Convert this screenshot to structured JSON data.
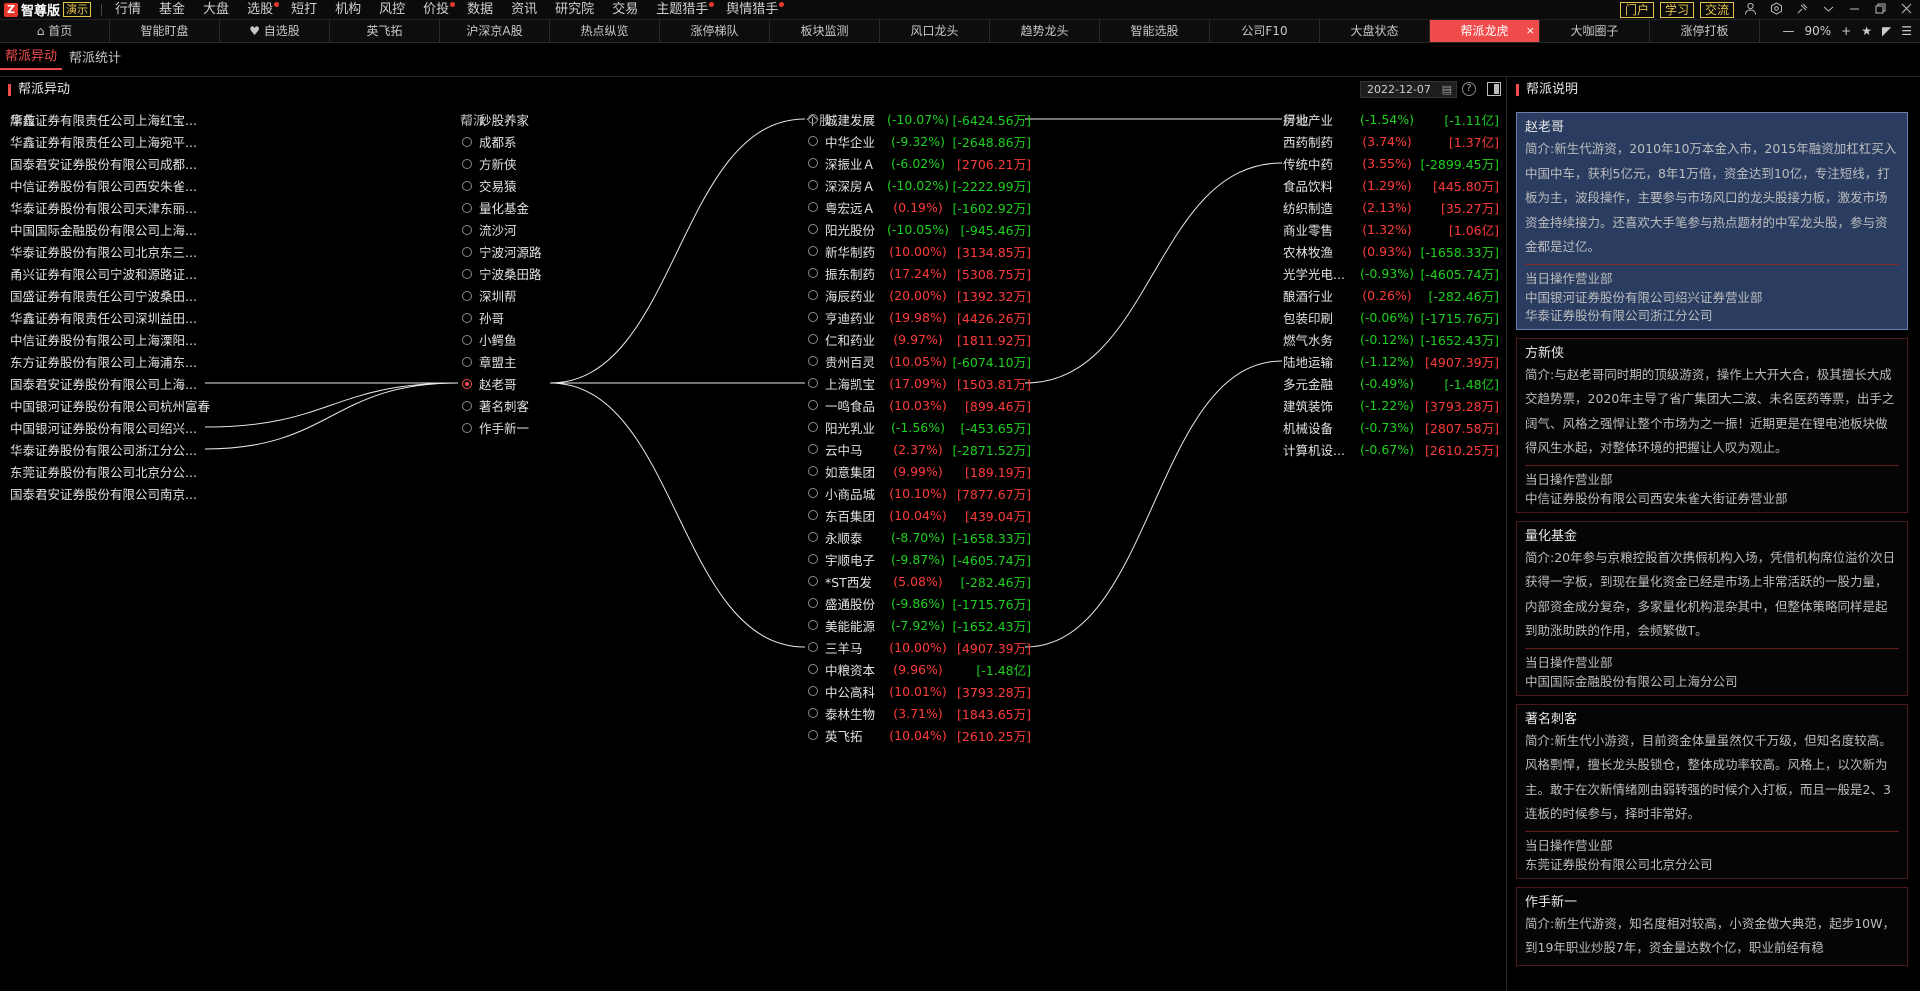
{
  "app": {
    "logo_text": "智尊版",
    "logo_badge": "演示",
    "menu": [
      {
        "label": "行情",
        "dot": false
      },
      {
        "label": "基金",
        "dot": false
      },
      {
        "label": "大盘",
        "dot": false
      },
      {
        "label": "选股",
        "dot": true
      },
      {
        "label": "短打",
        "dot": false
      },
      {
        "label": "机构",
        "dot": false
      },
      {
        "label": "风控",
        "dot": false
      },
      {
        "label": "价投",
        "dot": true
      },
      {
        "label": "数据",
        "dot": false
      },
      {
        "label": "资讯",
        "dot": false
      },
      {
        "label": "研究院",
        "dot": false
      },
      {
        "label": "交易",
        "dot": false
      },
      {
        "label": "主题猎手",
        "dot": true
      },
      {
        "label": "舆情猎手",
        "dot": true
      }
    ],
    "right_chips": [
      "门户",
      "学习",
      "交流"
    ],
    "right_icons": [
      "user-icon",
      "settings-icon",
      "pin-icon",
      "menu-icon",
      "minimize-icon",
      "restore-icon",
      "close-icon"
    ]
  },
  "tabs": [
    {
      "label": "首页",
      "icon": "home-icon"
    },
    {
      "label": "智能盯盘"
    },
    {
      "label": "自选股",
      "icon": "heart-icon"
    },
    {
      "label": "英飞拓"
    },
    {
      "label": "沪深京A股"
    },
    {
      "label": "热点纵览"
    },
    {
      "label": "涨停梯队"
    },
    {
      "label": "板块监测"
    },
    {
      "label": "风口龙头"
    },
    {
      "label": "趋势龙头"
    },
    {
      "label": "智能选股"
    },
    {
      "label": "公司F10"
    },
    {
      "label": "大盘状态"
    },
    {
      "label": "帮派龙虎",
      "active": true
    },
    {
      "label": "大咖圈子"
    },
    {
      "label": "涨停打板"
    }
  ],
  "zoom": "90%",
  "subtabs": [
    {
      "label": "帮派异动",
      "active": true
    },
    {
      "label": "帮派统计",
      "active": false
    }
  ],
  "main": {
    "title": "帮派异动",
    "date": "2022-12-07",
    "headers": {
      "seat": "席位",
      "group": "帮派",
      "stock": "个股",
      "industry": "行业"
    },
    "seats": [
      "华鑫证券有限责任公司上海红宝...",
      "华鑫证券有限责任公司上海宛平...",
      "国泰君安证券股份有限公司成都...",
      "中信证券股份有限公司西安朱雀...",
      "华泰证券股份有限公司天津东丽...",
      "中国国际金融股份有限公司上海...",
      "华泰证券股份有限公司北京东三...",
      "甬兴证券有限公司宁波和源路证...",
      "国盛证券有限责任公司宁波桑田...",
      "华鑫证券有限责任公司深圳益田...",
      "中信证券股份有限公司上海溧阳...",
      "东方证券股份有限公司上海浦东...",
      "国泰君安证券股份有限公司上海...",
      "中国银河证券股份有限公司杭州富春...",
      "中国银河证券股份有限公司绍兴...",
      "华泰证券股份有限公司浙江分公...",
      "东莞证券股份有限公司北京分公...",
      "国泰君安证券股份有限公司南京..."
    ],
    "groups": [
      {
        "name": "炒股养家",
        "selected": false
      },
      {
        "name": "成都系",
        "selected": false
      },
      {
        "name": "方新侠",
        "selected": false
      },
      {
        "name": "交易猿",
        "selected": false
      },
      {
        "name": "量化基金",
        "selected": false
      },
      {
        "name": "流沙河",
        "selected": false
      },
      {
        "name": "宁波河源路",
        "selected": false
      },
      {
        "name": "宁波桑田路",
        "selected": false
      },
      {
        "name": "深圳帮",
        "selected": false
      },
      {
        "name": "孙哥",
        "selected": false
      },
      {
        "name": "小鳄鱼",
        "selected": false
      },
      {
        "name": "章盟主",
        "selected": false
      },
      {
        "name": "赵老哥",
        "selected": true
      },
      {
        "name": "著名刺客",
        "selected": false
      },
      {
        "name": "作手新一",
        "selected": false
      }
    ],
    "stocks": [
      {
        "name": "城建发展",
        "pct": "(-10.07%)",
        "amount": "[-6424.56万]",
        "pct_dir": "down",
        "amt_dir": "down",
        "linked": true
      },
      {
        "name": "中华企业",
        "pct": "(-9.32%)",
        "amount": "[-2648.86万]",
        "pct_dir": "down",
        "amt_dir": "down",
        "linked": false
      },
      {
        "name": "深振业Ａ",
        "pct": "(-6.02%)",
        "amount": "[2706.21万]",
        "pct_dir": "down",
        "amt_dir": "up",
        "linked": false
      },
      {
        "name": "深深房Ａ",
        "pct": "(-10.02%)",
        "amount": "[-2222.99万]",
        "pct_dir": "down",
        "amt_dir": "down",
        "linked": false
      },
      {
        "name": "粤宏远Ａ",
        "pct": "(0.19%)",
        "amount": "[-1602.92万]",
        "pct_dir": "up",
        "amt_dir": "down",
        "linked": false
      },
      {
        "name": "阳光股份",
        "pct": "(-10.05%)",
        "amount": "[-945.46万]",
        "pct_dir": "down",
        "amt_dir": "down",
        "linked": false
      },
      {
        "name": "新华制药",
        "pct": "(10.00%)",
        "amount": "[3134.85万]",
        "pct_dir": "up",
        "amt_dir": "up",
        "linked": false
      },
      {
        "name": "振东制药",
        "pct": "(17.24%)",
        "amount": "[5308.75万]",
        "pct_dir": "up",
        "amt_dir": "up",
        "linked": false
      },
      {
        "name": "海辰药业",
        "pct": "(20.00%)",
        "amount": "[1392.32万]",
        "pct_dir": "up",
        "amt_dir": "up",
        "linked": false
      },
      {
        "name": "亨迪药业",
        "pct": "(19.98%)",
        "amount": "[4426.26万]",
        "pct_dir": "up",
        "amt_dir": "up",
        "linked": false
      },
      {
        "name": "仁和药业",
        "pct": "(9.97%)",
        "amount": "[1811.92万]",
        "pct_dir": "up",
        "amt_dir": "up",
        "linked": false
      },
      {
        "name": "贵州百灵",
        "pct": "(10.05%)",
        "amount": "[-6074.10万]",
        "pct_dir": "up",
        "amt_dir": "down",
        "linked": false
      },
      {
        "name": "上海凯宝",
        "pct": "(17.09%)",
        "amount": "[1503.81万]",
        "pct_dir": "up",
        "amt_dir": "up",
        "linked": true
      },
      {
        "name": "一鸣食品",
        "pct": "(10.03%)",
        "amount": "[899.46万]",
        "pct_dir": "up",
        "amt_dir": "up",
        "linked": false
      },
      {
        "name": "阳光乳业",
        "pct": "(-1.56%)",
        "amount": "[-453.65万]",
        "pct_dir": "down",
        "amt_dir": "down",
        "linked": false
      },
      {
        "name": "云中马",
        "pct": "(2.37%)",
        "amount": "[-2871.52万]",
        "pct_dir": "up",
        "amt_dir": "down",
        "linked": false
      },
      {
        "name": "如意集团",
        "pct": "(9.99%)",
        "amount": "[189.19万]",
        "pct_dir": "up",
        "amt_dir": "up",
        "linked": false
      },
      {
        "name": "小商品城",
        "pct": "(10.10%)",
        "amount": "[7877.67万]",
        "pct_dir": "up",
        "amt_dir": "up",
        "linked": false
      },
      {
        "name": "东百集团",
        "pct": "(10.04%)",
        "amount": "[439.04万]",
        "pct_dir": "up",
        "amt_dir": "up",
        "linked": false
      },
      {
        "name": "永顺泰",
        "pct": "(-8.70%)",
        "amount": "[-1658.33万]",
        "pct_dir": "down",
        "amt_dir": "down",
        "linked": false
      },
      {
        "name": "宇顺电子",
        "pct": "(-9.87%)",
        "amount": "[-4605.74万]",
        "pct_dir": "down",
        "amt_dir": "down",
        "linked": false
      },
      {
        "name": "*ST西发",
        "pct": "(5.08%)",
        "amount": "[-282.46万]",
        "pct_dir": "up",
        "amt_dir": "down",
        "linked": false
      },
      {
        "name": "盛通股份",
        "pct": "(-9.86%)",
        "amount": "[-1715.76万]",
        "pct_dir": "down",
        "amt_dir": "down",
        "linked": false
      },
      {
        "name": "美能能源",
        "pct": "(-7.92%)",
        "amount": "[-1652.43万]",
        "pct_dir": "down",
        "amt_dir": "down",
        "linked": false
      },
      {
        "name": "三羊马",
        "pct": "(10.00%)",
        "amount": "[4907.39万]",
        "pct_dir": "up",
        "amt_dir": "up",
        "linked": true
      },
      {
        "name": "中粮资本",
        "pct": "(9.96%)",
        "amount": "[-1.48亿]",
        "pct_dir": "up",
        "amt_dir": "down",
        "linked": false
      },
      {
        "name": "中公高科",
        "pct": "(10.01%)",
        "amount": "[3793.28万]",
        "pct_dir": "up",
        "amt_dir": "up",
        "linked": false
      },
      {
        "name": "泰林生物",
        "pct": "(3.71%)",
        "amount": "[1843.65万]",
        "pct_dir": "up",
        "amt_dir": "up",
        "linked": false
      },
      {
        "name": "英飞拓",
        "pct": "(10.04%)",
        "amount": "[2610.25万]",
        "pct_dir": "up",
        "amt_dir": "up",
        "linked": false
      }
    ],
    "industries": [
      {
        "name": "房地产业",
        "pct": "(-1.54%)",
        "amount": "[-1.11亿]",
        "pct_dir": "down",
        "amt_dir": "down"
      },
      {
        "name": "西药制药",
        "pct": "(3.74%)",
        "amount": "[1.37亿]",
        "pct_dir": "up",
        "amt_dir": "up"
      },
      {
        "name": "传统中药",
        "pct": "(3.55%)",
        "amount": "[-2899.45万]",
        "pct_dir": "up",
        "amt_dir": "down"
      },
      {
        "name": "食品饮料",
        "pct": "(1.29%)",
        "amount": "[445.80万]",
        "pct_dir": "up",
        "amt_dir": "up"
      },
      {
        "name": "纺织制造",
        "pct": "(2.13%)",
        "amount": "[35.27万]",
        "pct_dir": "up",
        "amt_dir": "up"
      },
      {
        "name": "商业零售",
        "pct": "(1.32%)",
        "amount": "[1.06亿]",
        "pct_dir": "up",
        "amt_dir": "up"
      },
      {
        "name": "农林牧渔",
        "pct": "(0.93%)",
        "amount": "[-1658.33万]",
        "pct_dir": "up",
        "amt_dir": "down"
      },
      {
        "name": "光学光电...",
        "pct": "(-0.93%)",
        "amount": "[-4605.74万]",
        "pct_dir": "down",
        "amt_dir": "down"
      },
      {
        "name": "酿酒行业",
        "pct": "(0.26%)",
        "amount": "[-282.46万]",
        "pct_dir": "up",
        "amt_dir": "down"
      },
      {
        "name": "包装印刷",
        "pct": "(-0.06%)",
        "amount": "[-1715.76万]",
        "pct_dir": "down",
        "amt_dir": "down"
      },
      {
        "name": "燃气水务",
        "pct": "(-0.12%)",
        "amount": "[-1652.43万]",
        "pct_dir": "down",
        "amt_dir": "down"
      },
      {
        "name": "陆地运输",
        "pct": "(-1.12%)",
        "amount": "[4907.39万]",
        "pct_dir": "down",
        "amt_dir": "up"
      },
      {
        "name": "多元金融",
        "pct": "(-0.49%)",
        "amount": "[-1.48亿]",
        "pct_dir": "down",
        "amt_dir": "down"
      },
      {
        "name": "建筑装饰",
        "pct": "(-1.22%)",
        "amount": "[3793.28万]",
        "pct_dir": "down",
        "amt_dir": "up"
      },
      {
        "name": "机械设备",
        "pct": "(-0.73%)",
        "amount": "[2807.58万]",
        "pct_dir": "down",
        "amt_dir": "up"
      },
      {
        "name": "计算机设...",
        "pct": "(-0.67%)",
        "amount": "[2610.25万]",
        "pct_dir": "down",
        "amt_dir": "up"
      }
    ],
    "links": {
      "seats_to_group": [
        12,
        14,
        15
      ],
      "group_index": 12,
      "group_to_stocks": [
        0,
        12,
        24
      ],
      "stock_to_industry": [
        [
          0,
          0
        ],
        [
          12,
          2
        ],
        [
          24,
          11
        ]
      ]
    }
  },
  "side": {
    "title": "帮派说明",
    "branch_label": "当日操作营业部",
    "cards": [
      {
        "name": "赵老哥",
        "selected": true,
        "intro": "简介:新生代游资，2010年10万本金入市，2015年融资加杠杠买入中国中车，获利5亿元，8年1万倍，资金达到10亿，专注短线，打板为主，波段操作，主要参与市场风口的龙头股接力板，激发市场资金持续接力。还喜欢大手笔参与热点题材的中军龙头股，参与资金都是过亿。",
        "branches": [
          "中国银河证券股份有限公司绍兴证券营业部",
          "华泰证券股份有限公司浙江分公司"
        ]
      },
      {
        "name": "方新侠",
        "selected": false,
        "intro": "简介:与赵老哥同时期的顶级游资，操作上大开大合，极其擅长大成交趋势票，2020年主导了省广集团大二波、未名医药等票，出手之阔气、风格之强悍让整个市场为之一振！近期更是在锂电池板块做得风生水起，对整体环境的把握让人叹为观止。",
        "branches": [
          "中信证券股份有限公司西安朱雀大街证券营业部"
        ]
      },
      {
        "name": "量化基金",
        "selected": false,
        "intro": "简介:20年参与京粮控股首次携假机构入场，凭借机构席位溢价次日获得一字板，到现在量化资金已经是市场上非常活跃的一股力量，内部资金成分复杂，多家量化机构混杂其中，但整体策略同样是起到助涨助跌的作用，会频繁做T。",
        "branches": [
          "中国国际金融股份有限公司上海分公司"
        ]
      },
      {
        "name": "著名刺客",
        "selected": false,
        "intro": "简介:新生代小游资，目前资金体量虽然仅千万级，但知名度较高。风格剽悍，擅长龙头股锁仓，整体成功率较高。风格上，以次新为主。敢于在次新情绪刚由弱转强的时候介入打板，而且一般是2、3连板的时候参与，择时非常好。",
        "branches": [
          "东莞证券股份有限公司北京分公司"
        ]
      },
      {
        "name": "作手新一",
        "selected": false,
        "intro": "简介:新生代游资，知名度相对较高，小资金做大典范，起步10W，到19年职业炒股7年，资金量达数个亿，职业前经有稳",
        "branches": []
      }
    ]
  },
  "colors": {
    "up": "#ff3b3b",
    "down": "#1fd11f",
    "accent": "#f04b4b",
    "selected_card": "#2a3d61"
  }
}
